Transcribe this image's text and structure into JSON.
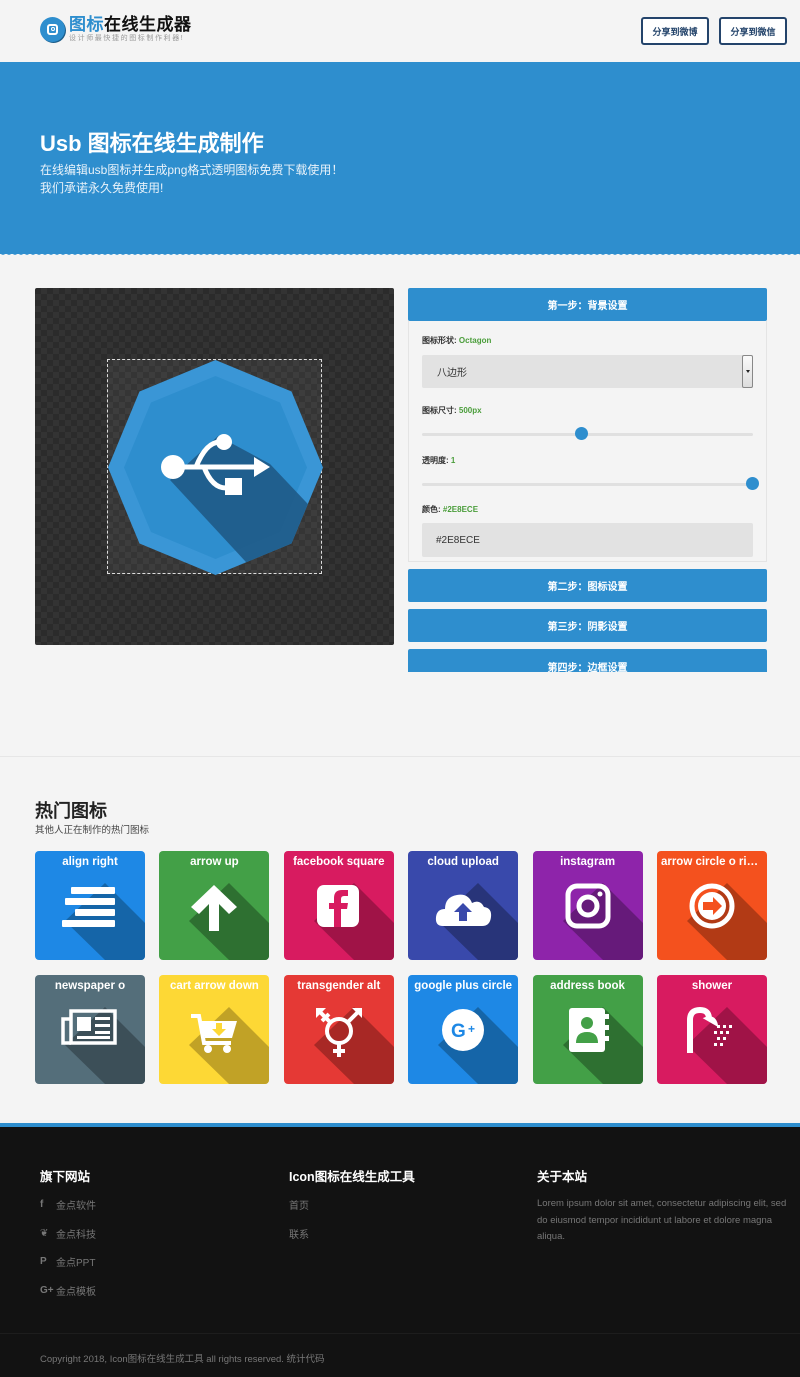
{
  "header": {
    "logo_title_blue": "图标",
    "logo_title_rest": "在线生成器",
    "logo_subtitle": "设计师最快捷的图标制作利器!",
    "share_weibo": "分享到微博",
    "share_weixin": "分享到微信"
  },
  "hero": {
    "title": "Usb 图标在线生成制作",
    "line1": "在线编辑usb图标并生成png格式透明图标免费下载使用！",
    "line2": "我们承诺永久免费使用!"
  },
  "editor": {
    "preview_icon": "usb-icon",
    "preview_shape": "octagon",
    "preview_color": "#2E8ECE",
    "steps": [
      {
        "label": "第一步：背景设置"
      },
      {
        "label": "第二步：图标设置"
      },
      {
        "label": "第三步：阴影设置"
      },
      {
        "label": "第四步：边框设置"
      }
    ],
    "shape_label": "图标形状:",
    "shape_value": "Octagon",
    "shape_select": "八边形",
    "size_label": "图标尺寸:",
    "size_value": "500px",
    "size_slider_fraction": 0.48,
    "opacity_label": "透明度:",
    "opacity_value": "1",
    "opacity_slider_fraction": 1.0,
    "color_label": "颜色:",
    "color_value": "#2E8ECE",
    "color_input": "#2E8ECE"
  },
  "popular": {
    "title": "热门图标",
    "subtitle": "其他人正在制作的热门图标",
    "icons": [
      {
        "label": "align right",
        "icon": "align-right-icon",
        "color": "#1e88e5",
        "shadow": "#1565a8"
      },
      {
        "label": "arrow up",
        "icon": "arrow-up-icon",
        "color": "#43a047",
        "shadow": "#2e7031"
      },
      {
        "label": "facebook square",
        "icon": "facebook-square-icon",
        "color": "#d81b60",
        "shadow": "#a01347"
      },
      {
        "label": "cloud upload",
        "icon": "cloud-upload-icon",
        "color": "#3949ab",
        "shadow": "#283479"
      },
      {
        "label": "instagram",
        "icon": "instagram-icon",
        "color": "#8e24aa",
        "shadow": "#661a7a"
      },
      {
        "label": "arrow circle o rig...",
        "icon": "arrow-circle-right-icon",
        "color": "#f4511e",
        "shadow": "#b23a15"
      },
      {
        "label": "newspaper o",
        "icon": "newspaper-icon",
        "color": "#546e7a",
        "shadow": "#3c4f58"
      },
      {
        "label": "cart arrow down",
        "icon": "cart-arrow-down-icon",
        "color": "#fdd835",
        "shadow": "#c1a226"
      },
      {
        "label": "transgender alt",
        "icon": "transgender-icon",
        "color": "#e53935",
        "shadow": "#a82825"
      },
      {
        "label": "google plus circle",
        "icon": "google-plus-circle-icon",
        "color": "#1e88e5",
        "shadow": "#1565a8"
      },
      {
        "label": "address book",
        "icon": "address-book-icon",
        "color": "#43a047",
        "shadow": "#2e7031"
      },
      {
        "label": "shower",
        "icon": "shower-icon",
        "color": "#d81b60",
        "shadow": "#a01347"
      }
    ]
  },
  "footer": {
    "col1_title": "旗下网站",
    "col1_links": [
      {
        "icon": "facebook-icon",
        "glyph": "f",
        "label": "金点软件"
      },
      {
        "icon": "twitter-icon",
        "glyph": "🐦",
        "label": "金点科技"
      },
      {
        "icon": "pinterest-icon",
        "glyph": "P",
        "label": "金点PPT"
      },
      {
        "icon": "google-plus-icon",
        "glyph": "G+",
        "label": "金点模板"
      }
    ],
    "col2_title": "Icon图标在线生成工具",
    "col2_links": [
      "首页",
      "联系"
    ],
    "col3_title": "关于本站",
    "col3_text": "Lorem ipsum dolor sit amet, consectetur adipiscing elit, sed do eiusmod tempor incididunt ut labore et dolore magna aliqua.",
    "copyright": "Copyright 2018, Icon图标在线生成工具 all rights reserved. 统计代码"
  }
}
